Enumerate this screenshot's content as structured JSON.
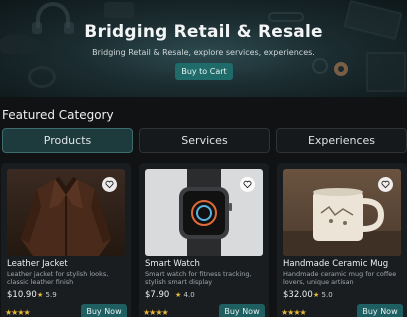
{
  "hero": {
    "title": "Bridging Retail & Resale",
    "subtitle": "Bridging Retail & Resale, explore services, experiences.",
    "cta_label": "Buy to Cart"
  },
  "section": {
    "title": "Featured Category"
  },
  "tabs": [
    {
      "label": "Products",
      "active": true
    },
    {
      "label": "Services",
      "active": false
    },
    {
      "label": "Experiences",
      "active": false
    }
  ],
  "products": [
    {
      "title": "Leather Jacket",
      "description": "Leather jacket for stylish looks, classic leather finish",
      "price": "$10.90",
      "rating": "5.9",
      "buy_label": "Buy Now",
      "image_icon": "leather-jacket-image",
      "favorite_icon": "heart-icon"
    },
    {
      "title": "Smart Watch",
      "description": "Smart watch for fitness tracking, stylish smart display",
      "price": "$7.90",
      "rating": "4.0",
      "buy_label": "Buy Now",
      "image_icon": "smart-watch-image",
      "favorite_icon": "heart-icon"
    },
    {
      "title": "Handmade Ceramic Mug",
      "description": "Handmade ceramic mug for coffee lovers, unique artisan",
      "price": "$32.00",
      "rating": "5.0",
      "buy_label": "Buy Now",
      "image_icon": "ceramic-mug-image",
      "favorite_icon": "heart-icon"
    }
  ],
  "colors": {
    "accent": "#1f6b6a",
    "star": "#e8b93a",
    "background": "#101214",
    "card": "#1a1d20"
  }
}
